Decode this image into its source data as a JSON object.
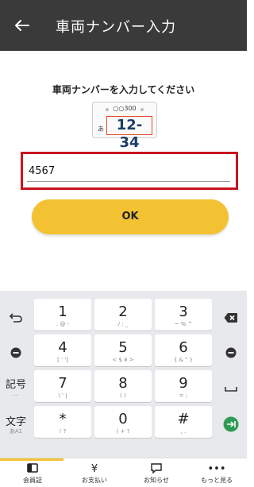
{
  "header": {
    "title": "車両ナンバー入力",
    "back_icon": "arrow-left-icon"
  },
  "prompt": "車両ナンバーを入力してください",
  "plate_example": {
    "region": "○○300",
    "kana": "あ",
    "number": "12-34"
  },
  "input": {
    "value": "4567"
  },
  "ok_button": "OK",
  "keyboard": {
    "left": [
      {
        "icon": "undo-icon"
      },
      {
        "icon": "cursor-left-icon"
      },
      {
        "label": "記号",
        "sub": "…"
      },
      {
        "label": "文字",
        "sub": "あA1"
      }
    ],
    "keys": [
      [
        {
          "main": "1",
          "sub": ". @ -"
        },
        {
          "main": "2",
          "sub": "/ : _"
        },
        {
          "main": "3",
          "sub": "~ % ^"
        }
      ],
      [
        {
          "main": "4",
          "sub": "[ ' ']"
        },
        {
          "main": "5",
          "sub": "< $ ¥ >"
        },
        {
          "main": "6",
          "sub": "{ & \" }"
        }
      ],
      [
        {
          "main": "7",
          "sub": "\\ ' |"
        },
        {
          "main": "8",
          "sub": "( )"
        },
        {
          "main": "9",
          "sub": "= ;"
        }
      ],
      [
        {
          "main": "*",
          "sub": "! ?"
        },
        {
          "main": "0",
          "sub": "( + ?"
        },
        {
          "main": "#",
          "sub": ", ."
        }
      ]
    ],
    "right": [
      {
        "icon": "backspace-icon"
      },
      {
        "icon": "cursor-right-icon"
      },
      {
        "icon": "space-icon"
      },
      {
        "icon": "enter-icon"
      }
    ]
  },
  "bottom_nav": [
    {
      "label": "会員証",
      "icon": "card-icon"
    },
    {
      "label": "お支払い",
      "icon": "yen-icon"
    },
    {
      "label": "お知らせ",
      "icon": "message-icon"
    },
    {
      "label": "もっと見る",
      "icon": "more-icon"
    }
  ],
  "colors": {
    "header": "#3a3a3a",
    "accent": "#f3c232",
    "highlight": "#c8141e",
    "enter": "#2e9b54"
  }
}
